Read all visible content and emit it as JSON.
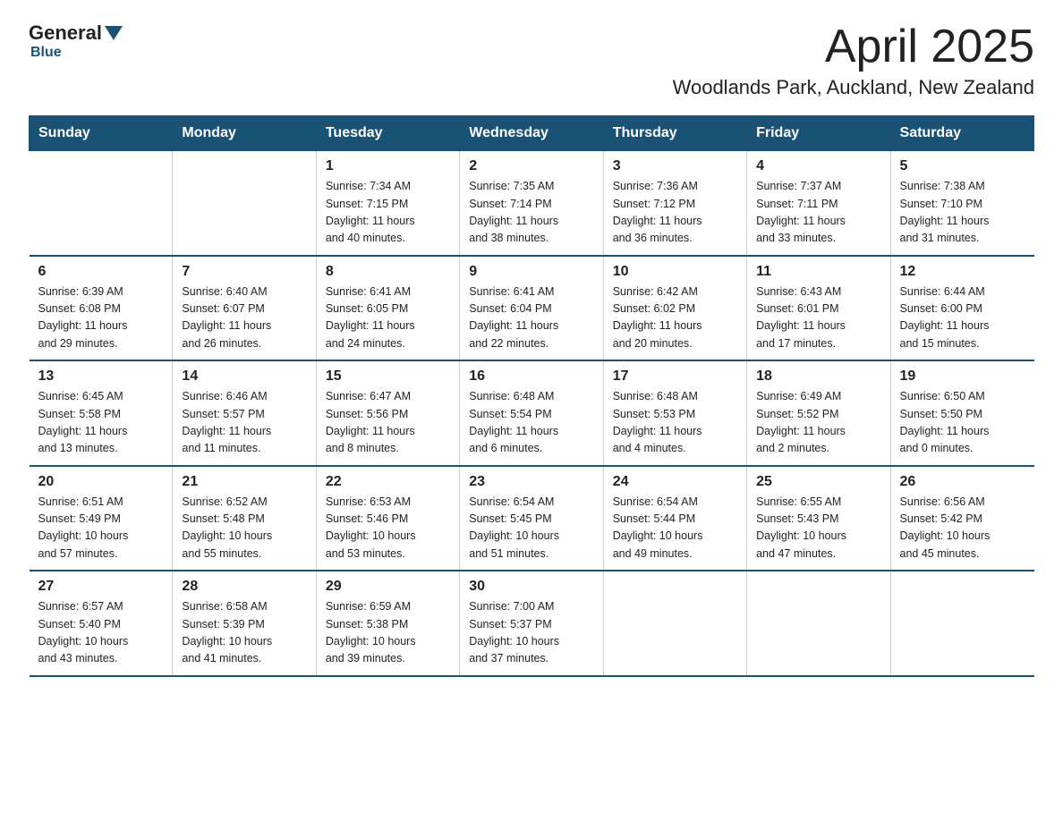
{
  "logo": {
    "general": "General",
    "blue": "Blue"
  },
  "header": {
    "month_year": "April 2025",
    "location": "Woodlands Park, Auckland, New Zealand"
  },
  "weekdays": [
    "Sunday",
    "Monday",
    "Tuesday",
    "Wednesday",
    "Thursday",
    "Friday",
    "Saturday"
  ],
  "weeks": [
    [
      {
        "day": "",
        "info": ""
      },
      {
        "day": "",
        "info": ""
      },
      {
        "day": "1",
        "info": "Sunrise: 7:34 AM\nSunset: 7:15 PM\nDaylight: 11 hours\nand 40 minutes."
      },
      {
        "day": "2",
        "info": "Sunrise: 7:35 AM\nSunset: 7:14 PM\nDaylight: 11 hours\nand 38 minutes."
      },
      {
        "day": "3",
        "info": "Sunrise: 7:36 AM\nSunset: 7:12 PM\nDaylight: 11 hours\nand 36 minutes."
      },
      {
        "day": "4",
        "info": "Sunrise: 7:37 AM\nSunset: 7:11 PM\nDaylight: 11 hours\nand 33 minutes."
      },
      {
        "day": "5",
        "info": "Sunrise: 7:38 AM\nSunset: 7:10 PM\nDaylight: 11 hours\nand 31 minutes."
      }
    ],
    [
      {
        "day": "6",
        "info": "Sunrise: 6:39 AM\nSunset: 6:08 PM\nDaylight: 11 hours\nand 29 minutes."
      },
      {
        "day": "7",
        "info": "Sunrise: 6:40 AM\nSunset: 6:07 PM\nDaylight: 11 hours\nand 26 minutes."
      },
      {
        "day": "8",
        "info": "Sunrise: 6:41 AM\nSunset: 6:05 PM\nDaylight: 11 hours\nand 24 minutes."
      },
      {
        "day": "9",
        "info": "Sunrise: 6:41 AM\nSunset: 6:04 PM\nDaylight: 11 hours\nand 22 minutes."
      },
      {
        "day": "10",
        "info": "Sunrise: 6:42 AM\nSunset: 6:02 PM\nDaylight: 11 hours\nand 20 minutes."
      },
      {
        "day": "11",
        "info": "Sunrise: 6:43 AM\nSunset: 6:01 PM\nDaylight: 11 hours\nand 17 minutes."
      },
      {
        "day": "12",
        "info": "Sunrise: 6:44 AM\nSunset: 6:00 PM\nDaylight: 11 hours\nand 15 minutes."
      }
    ],
    [
      {
        "day": "13",
        "info": "Sunrise: 6:45 AM\nSunset: 5:58 PM\nDaylight: 11 hours\nand 13 minutes."
      },
      {
        "day": "14",
        "info": "Sunrise: 6:46 AM\nSunset: 5:57 PM\nDaylight: 11 hours\nand 11 minutes."
      },
      {
        "day": "15",
        "info": "Sunrise: 6:47 AM\nSunset: 5:56 PM\nDaylight: 11 hours\nand 8 minutes."
      },
      {
        "day": "16",
        "info": "Sunrise: 6:48 AM\nSunset: 5:54 PM\nDaylight: 11 hours\nand 6 minutes."
      },
      {
        "day": "17",
        "info": "Sunrise: 6:48 AM\nSunset: 5:53 PM\nDaylight: 11 hours\nand 4 minutes."
      },
      {
        "day": "18",
        "info": "Sunrise: 6:49 AM\nSunset: 5:52 PM\nDaylight: 11 hours\nand 2 minutes."
      },
      {
        "day": "19",
        "info": "Sunrise: 6:50 AM\nSunset: 5:50 PM\nDaylight: 11 hours\nand 0 minutes."
      }
    ],
    [
      {
        "day": "20",
        "info": "Sunrise: 6:51 AM\nSunset: 5:49 PM\nDaylight: 10 hours\nand 57 minutes."
      },
      {
        "day": "21",
        "info": "Sunrise: 6:52 AM\nSunset: 5:48 PM\nDaylight: 10 hours\nand 55 minutes."
      },
      {
        "day": "22",
        "info": "Sunrise: 6:53 AM\nSunset: 5:46 PM\nDaylight: 10 hours\nand 53 minutes."
      },
      {
        "day": "23",
        "info": "Sunrise: 6:54 AM\nSunset: 5:45 PM\nDaylight: 10 hours\nand 51 minutes."
      },
      {
        "day": "24",
        "info": "Sunrise: 6:54 AM\nSunset: 5:44 PM\nDaylight: 10 hours\nand 49 minutes."
      },
      {
        "day": "25",
        "info": "Sunrise: 6:55 AM\nSunset: 5:43 PM\nDaylight: 10 hours\nand 47 minutes."
      },
      {
        "day": "26",
        "info": "Sunrise: 6:56 AM\nSunset: 5:42 PM\nDaylight: 10 hours\nand 45 minutes."
      }
    ],
    [
      {
        "day": "27",
        "info": "Sunrise: 6:57 AM\nSunset: 5:40 PM\nDaylight: 10 hours\nand 43 minutes."
      },
      {
        "day": "28",
        "info": "Sunrise: 6:58 AM\nSunset: 5:39 PM\nDaylight: 10 hours\nand 41 minutes."
      },
      {
        "day": "29",
        "info": "Sunrise: 6:59 AM\nSunset: 5:38 PM\nDaylight: 10 hours\nand 39 minutes."
      },
      {
        "day": "30",
        "info": "Sunrise: 7:00 AM\nSunset: 5:37 PM\nDaylight: 10 hours\nand 37 minutes."
      },
      {
        "day": "",
        "info": ""
      },
      {
        "day": "",
        "info": ""
      },
      {
        "day": "",
        "info": ""
      }
    ]
  ]
}
